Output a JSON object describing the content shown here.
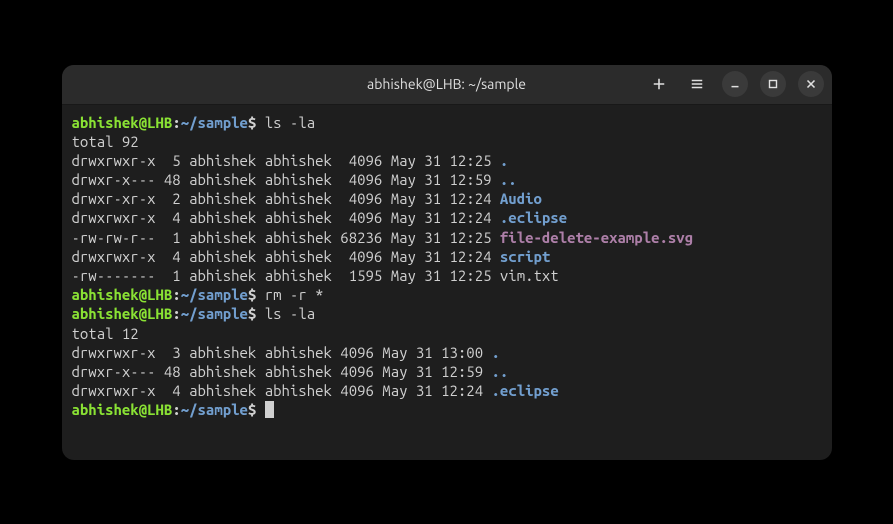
{
  "window": {
    "title": "abhishek@LHB: ~/sample"
  },
  "prompt": {
    "user_host": "abhishek@LHB",
    "sep1": ":",
    "path": "~/sample",
    "dollar": "$"
  },
  "commands": {
    "cmd1": "ls -la",
    "cmd2": "rm -r *",
    "cmd3": "ls -la"
  },
  "output1": {
    "total": "total 92",
    "rows": [
      {
        "perm": "drwxrwxr-x  5 abhishek abhishek  4096 May 31 12:25 ",
        "name": ".",
        "cls": "dir"
      },
      {
        "perm": "drwxr-x--- 48 abhishek abhishek  4096 May 31 12:59 ",
        "name": "..",
        "cls": "dir"
      },
      {
        "perm": "drwxr-xr-x  2 abhishek abhishek  4096 May 31 12:24 ",
        "name": "Audio",
        "cls": "dir"
      },
      {
        "perm": "drwxrwxr-x  4 abhishek abhishek  4096 May 31 12:24 ",
        "name": ".eclipse",
        "cls": "dir"
      },
      {
        "perm": "-rw-rw-r--  1 abhishek abhishek 68236 May 31 12:25 ",
        "name": "file-delete-example.svg",
        "cls": "img"
      },
      {
        "perm": "drwxrwxr-x  4 abhishek abhishek  4096 May 31 12:24 ",
        "name": "script",
        "cls": "dir"
      },
      {
        "perm": "-rw-------  1 abhishek abhishek  1595 May 31 12:25 ",
        "name": "vim.txt",
        "cls": "txt"
      }
    ]
  },
  "output2": {
    "total": "total 12",
    "rows": [
      {
        "perm": "drwxrwxr-x  3 abhishek abhishek 4096 May 31 13:00 ",
        "name": ".",
        "cls": "dir"
      },
      {
        "perm": "drwxr-x--- 48 abhishek abhishek 4096 May 31 12:59 ",
        "name": "..",
        "cls": "dir"
      },
      {
        "perm": "drwxrwxr-x  4 abhishek abhishek 4096 May 31 12:24 ",
        "name": ".eclipse",
        "cls": "dir"
      }
    ]
  }
}
